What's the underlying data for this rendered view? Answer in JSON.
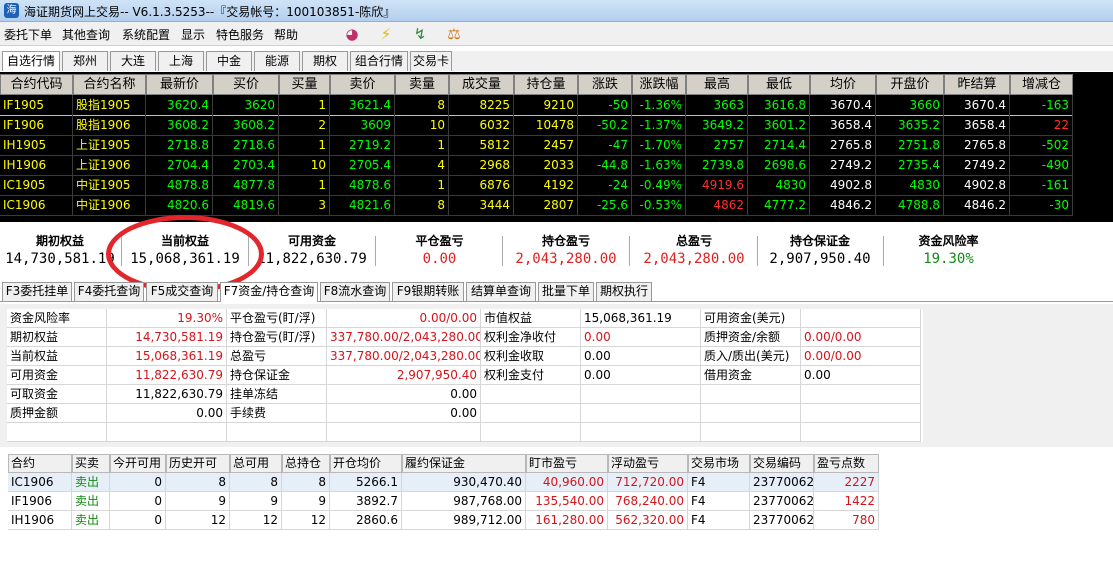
{
  "window": {
    "title": "海证期货网上交易-- V6.1.3.5253--『交易帐号：100103851-陈欣』"
  },
  "menu": {
    "items": [
      "委托下单",
      "其他查询",
      "系统配置",
      "显示",
      "特色服务",
      "帮助"
    ]
  },
  "toolbar": {
    "icons": [
      "pie-chart-icon",
      "lightning-icon",
      "chart-icon",
      "scale-icon"
    ]
  },
  "market_tabs": [
    "自选行情",
    "郑州",
    "大连",
    "上海",
    "中金",
    "能源",
    "期权",
    "组合行情",
    "交易卡"
  ],
  "quote": {
    "headers": [
      "合约代码",
      "合约名称",
      "最新价",
      "买价",
      "买量",
      "卖价",
      "卖量",
      "成交量",
      "持仓量",
      "涨跌",
      "涨跌幅",
      "最高",
      "最低",
      "均价",
      "开盘价",
      "昨结算",
      "增减仓"
    ],
    "rows": [
      [
        "IF1905",
        "股指1905",
        "3620.4",
        "3620",
        "1",
        "3621.4",
        "8",
        "8225",
        "9210",
        "-50",
        "-1.36%",
        "3663",
        "3616.8",
        "3670.4",
        "3660",
        "3670.4",
        "-163"
      ],
      [
        "IF1906",
        "股指1906",
        "3608.2",
        "3608.2",
        "2",
        "3609",
        "10",
        "6032",
        "10478",
        "-50.2",
        "-1.37%",
        "3649.2",
        "3601.2",
        "3658.4",
        "3635.2",
        "3658.4",
        "22"
      ],
      [
        "IH1905",
        "上证1905",
        "2718.8",
        "2718.6",
        "1",
        "2719.2",
        "1",
        "5812",
        "2457",
        "-47",
        "-1.70%",
        "2757",
        "2714.4",
        "2765.8",
        "2751.8",
        "2765.8",
        "-502"
      ],
      [
        "IH1906",
        "上证1906",
        "2704.4",
        "2703.4",
        "10",
        "2705.4",
        "4",
        "2968",
        "2033",
        "-44.8",
        "-1.63%",
        "2739.8",
        "2698.6",
        "2749.2",
        "2735.4",
        "2749.2",
        "-490"
      ],
      [
        "IC1905",
        "中证1905",
        "4878.8",
        "4877.8",
        "1",
        "4878.6",
        "1",
        "6876",
        "4192",
        "-24",
        "-0.49%",
        "4919.6",
        "4830",
        "4902.8",
        "4830",
        "4902.8",
        "-161"
      ],
      [
        "IC1906",
        "中证1906",
        "4820.6",
        "4819.6",
        "3",
        "4821.6",
        "8",
        "3444",
        "2807",
        "-25.6",
        "-0.53%",
        "4862",
        "4777.2",
        "4846.2",
        "4788.8",
        "4846.2",
        "-30"
      ]
    ],
    "colors": [
      [
        "yel",
        "yel",
        "grn",
        "grn",
        "yel",
        "grn",
        "yel",
        "yel",
        "yel",
        "grn",
        "grn",
        "grn",
        "grn",
        "wht",
        "grn",
        "wht",
        "grn"
      ],
      [
        "yel",
        "yel",
        "grn",
        "grn",
        "yel",
        "grn",
        "yel",
        "yel",
        "yel",
        "grn",
        "grn",
        "grn",
        "grn",
        "wht",
        "grn",
        "wht",
        "red"
      ],
      [
        "yel",
        "yel",
        "grn",
        "grn",
        "yel",
        "grn",
        "yel",
        "yel",
        "yel",
        "grn",
        "grn",
        "grn",
        "grn",
        "wht",
        "grn",
        "wht",
        "grn"
      ],
      [
        "yel",
        "yel",
        "grn",
        "grn",
        "yel",
        "grn",
        "yel",
        "yel",
        "yel",
        "grn",
        "grn",
        "grn",
        "grn",
        "wht",
        "grn",
        "wht",
        "grn"
      ],
      [
        "yel",
        "yel",
        "grn",
        "grn",
        "yel",
        "grn",
        "yel",
        "yel",
        "yel",
        "grn",
        "grn",
        "red",
        "grn",
        "wht",
        "grn",
        "wht",
        "grn"
      ],
      [
        "yel",
        "yel",
        "grn",
        "grn",
        "yel",
        "grn",
        "yel",
        "yel",
        "yel",
        "grn",
        "grn",
        "red",
        "grn",
        "wht",
        "grn",
        "wht",
        "grn"
      ]
    ]
  },
  "summary": [
    {
      "label": "期初权益",
      "value": "14,730,581.19",
      "color": "#000000"
    },
    {
      "label": "当前权益",
      "value": "15,068,361.19",
      "color": "#000000"
    },
    {
      "label": "可用资金",
      "value": "11,822,630.79",
      "color": "#000000"
    },
    {
      "label": "平仓盈亏",
      "value": "0.00",
      "color": "#e02020"
    },
    {
      "label": "持仓盈亏",
      "value": "2,043,280.00",
      "color": "#e02020"
    },
    {
      "label": "总盈亏",
      "value": "2,043,280.00",
      "color": "#e02020"
    },
    {
      "label": "持仓保证金",
      "value": "2,907,950.40",
      "color": "#000000"
    },
    {
      "label": "资金风险率",
      "value": "19.30%",
      "color": "#138a13"
    }
  ],
  "func_tabs": [
    "F3委托挂单",
    "F4委托查询",
    "F5成交查询",
    "F7资金/持仓查询",
    "F8流水查询",
    "F9银期转账",
    "结算单查询",
    "批量下单",
    "期权执行"
  ],
  "fund": {
    "col1": [
      [
        "资金风险率",
        "19.30%"
      ],
      [
        "期初权益",
        "14,730,581.19"
      ],
      [
        "当前权益",
        "15,068,361.19"
      ],
      [
        "可用资金",
        "11,822,630.79"
      ],
      [
        "可取资金",
        "11,822,630.79"
      ],
      [
        "质押金额",
        "0.00"
      ]
    ],
    "col2": [
      [
        "平仓盈亏(盯/浮)",
        "0.00/0.00"
      ],
      [
        "持仓盈亏(盯/浮)",
        "337,780.00/2,043,280.00"
      ],
      [
        "总盈亏",
        "337,780.00/2,043,280.00"
      ],
      [
        "持仓保证金",
        "2,907,950.40"
      ],
      [
        "挂单冻结",
        "0.00"
      ],
      [
        "手续费",
        "0.00"
      ]
    ],
    "col3": [
      [
        "市值权益",
        "15,068,361.19"
      ],
      [
        "权利金净收付",
        "0.00"
      ],
      [
        "权利金收取",
        "0.00"
      ],
      [
        "权利金支付",
        "0.00"
      ]
    ],
    "col4": [
      [
        "可用资金(美元)",
        ""
      ],
      [
        "质押资金/余额",
        "0.00/0.00"
      ],
      [
        "质入/质出(美元)",
        "0.00/0.00"
      ],
      [
        "借用资金",
        "0.00"
      ]
    ],
    "col1_colors": [
      "#d4141a",
      "#d4141a",
      "#d4141a",
      "#d4141a",
      "#000000",
      "#000000"
    ],
    "col2_colors": [
      "#d4141a",
      "#d4141a",
      "#d4141a",
      "#d4141a",
      "#000000",
      "#000000"
    ],
    "col3_colors": [
      "#000000",
      "#d4141a",
      "#000000",
      "#000000"
    ],
    "col4_colors": [
      "#000000",
      "#d4141a",
      "#d4141a",
      "#000000"
    ]
  },
  "positions": {
    "headers": [
      "合约",
      "买卖",
      "今开可用",
      "历史开可",
      "总可用",
      "总持仓",
      "开仓均价",
      "履约保证金",
      "盯市盈亏",
      "浮动盈亏",
      "交易市场",
      "交易编码",
      "盈亏点数"
    ],
    "rows": [
      [
        "IC1906",
        "卖出",
        "0",
        "8",
        "8",
        "8",
        "5266.1",
        "930,470.40",
        "40,960.00",
        "712,720.00",
        "F4",
        "23770062",
        "2227"
      ],
      [
        "IF1906",
        "卖出",
        "0",
        "9",
        "9",
        "9",
        "3892.7",
        "987,768.00",
        "135,540.00",
        "768,240.00",
        "F4",
        "23770062",
        "1422"
      ],
      [
        "IH1906",
        "卖出",
        "0",
        "12",
        "12",
        "12",
        "2860.6",
        "989,712.00",
        "161,280.00",
        "562,320.00",
        "F4",
        "23770062",
        "780"
      ]
    ]
  }
}
